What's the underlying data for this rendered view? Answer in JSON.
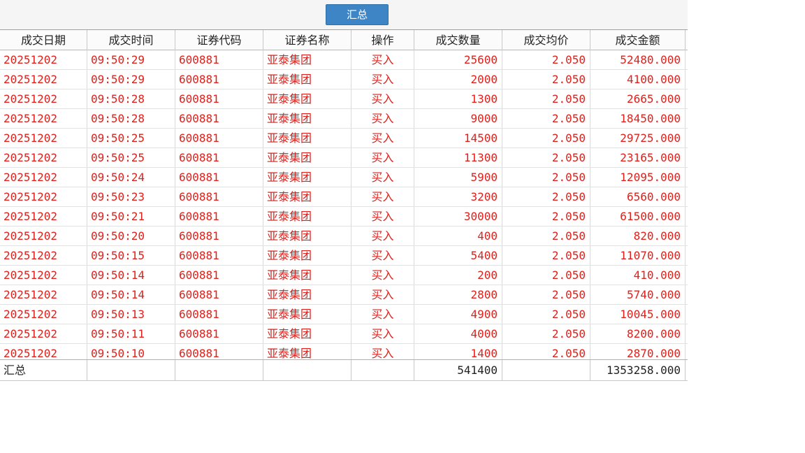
{
  "toolbar": {
    "summary_button": "汇总"
  },
  "columns": [
    "成交日期",
    "成交时间",
    "证券代码",
    "证券名称",
    "操作",
    "成交数量",
    "成交均价",
    "成交金额"
  ],
  "rows": [
    {
      "date": "20251202",
      "time": "09:50:29",
      "code": "600881",
      "name": "亚泰集团",
      "op": "买入",
      "qty": "25600",
      "price": "2.050",
      "amount": "52480.000"
    },
    {
      "date": "20251202",
      "time": "09:50:29",
      "code": "600881",
      "name": "亚泰集团",
      "op": "买入",
      "qty": "2000",
      "price": "2.050",
      "amount": "4100.000"
    },
    {
      "date": "20251202",
      "time": "09:50:28",
      "code": "600881",
      "name": "亚泰集团",
      "op": "买入",
      "qty": "1300",
      "price": "2.050",
      "amount": "2665.000"
    },
    {
      "date": "20251202",
      "time": "09:50:28",
      "code": "600881",
      "name": "亚泰集团",
      "op": "买入",
      "qty": "9000",
      "price": "2.050",
      "amount": "18450.000"
    },
    {
      "date": "20251202",
      "time": "09:50:25",
      "code": "600881",
      "name": "亚泰集团",
      "op": "买入",
      "qty": "14500",
      "price": "2.050",
      "amount": "29725.000"
    },
    {
      "date": "20251202",
      "time": "09:50:25",
      "code": "600881",
      "name": "亚泰集团",
      "op": "买入",
      "qty": "11300",
      "price": "2.050",
      "amount": "23165.000"
    },
    {
      "date": "20251202",
      "time": "09:50:24",
      "code": "600881",
      "name": "亚泰集团",
      "op": "买入",
      "qty": "5900",
      "price": "2.050",
      "amount": "12095.000"
    },
    {
      "date": "20251202",
      "time": "09:50:23",
      "code": "600881",
      "name": "亚泰集团",
      "op": "买入",
      "qty": "3200",
      "price": "2.050",
      "amount": "6560.000"
    },
    {
      "date": "20251202",
      "time": "09:50:21",
      "code": "600881",
      "name": "亚泰集团",
      "op": "买入",
      "qty": "30000",
      "price": "2.050",
      "amount": "61500.000"
    },
    {
      "date": "20251202",
      "time": "09:50:20",
      "code": "600881",
      "name": "亚泰集团",
      "op": "买入",
      "qty": "400",
      "price": "2.050",
      "amount": "820.000"
    },
    {
      "date": "20251202",
      "time": "09:50:15",
      "code": "600881",
      "name": "亚泰集团",
      "op": "买入",
      "qty": "5400",
      "price": "2.050",
      "amount": "11070.000"
    },
    {
      "date": "20251202",
      "time": "09:50:14",
      "code": "600881",
      "name": "亚泰集团",
      "op": "买入",
      "qty": "200",
      "price": "2.050",
      "amount": "410.000"
    },
    {
      "date": "20251202",
      "time": "09:50:14",
      "code": "600881",
      "name": "亚泰集团",
      "op": "买入",
      "qty": "2800",
      "price": "2.050",
      "amount": "5740.000"
    },
    {
      "date": "20251202",
      "time": "09:50:13",
      "code": "600881",
      "name": "亚泰集团",
      "op": "买入",
      "qty": "4900",
      "price": "2.050",
      "amount": "10045.000"
    },
    {
      "date": "20251202",
      "time": "09:50:11",
      "code": "600881",
      "name": "亚泰集团",
      "op": "买入",
      "qty": "4000",
      "price": "2.050",
      "amount": "8200.000"
    },
    {
      "date": "20251202",
      "time": "09:50:10",
      "code": "600881",
      "name": "亚泰集团",
      "op": "买入",
      "qty": "1400",
      "price": "2.050",
      "amount": "2870.000"
    }
  ],
  "summary": {
    "label": "汇总",
    "qty": "541400",
    "amount": "1353258.000"
  },
  "colors": {
    "buy_text": "#e0201b",
    "button_bg": "#3e85c6"
  }
}
